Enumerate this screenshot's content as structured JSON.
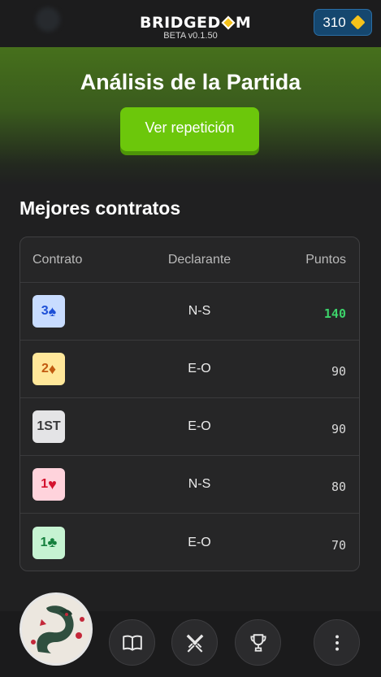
{
  "header": {
    "logo_text": "BRIDGEDOM",
    "logo_left": "BRIDGED",
    "logo_right": "M",
    "version": "BETA v0.1.50",
    "coins": "310"
  },
  "hero": {
    "title": "Análisis de la Partida",
    "replay_label": "Ver repetición"
  },
  "section": {
    "title": "Mejores contratos",
    "columns": [
      "Contrato",
      "Declarante",
      "Puntos"
    ],
    "rows": [
      {
        "level": "3",
        "suit_symbol": "♠",
        "suit": "spades",
        "declarer": "N-S",
        "points": "140",
        "badge_bg": "#c8dcff",
        "badge_fg": "#1d4fd6"
      },
      {
        "level": "2",
        "suit_symbol": "♦",
        "suit": "diamonds",
        "declarer": "E-O",
        "points": "90",
        "badge_bg": "#ffe79a",
        "badge_fg": "#c15a10"
      },
      {
        "level": "1ST",
        "suit_symbol": "",
        "suit": "no-trump",
        "declarer": "E-O",
        "points": "90",
        "badge_bg": "#e4e4e6",
        "badge_fg": "#3a3a3c"
      },
      {
        "level": "1",
        "suit_symbol": "♥",
        "suit": "hearts",
        "declarer": "N-S",
        "points": "80",
        "badge_bg": "#ffd3dc",
        "badge_fg": "#d4122e"
      },
      {
        "level": "1",
        "suit_symbol": "♣",
        "suit": "clubs",
        "declarer": "E-O",
        "points": "70",
        "badge_bg": "#c6f3d2",
        "badge_fg": "#15803d"
      }
    ]
  },
  "nav": {
    "items": [
      "book-icon",
      "crossed-swords-icon",
      "trophy-icon",
      "more-vertical-icon"
    ]
  },
  "colors": {
    "accent_green": "#6cc70b",
    "best_points": "#3cd36a",
    "coin": "#f6c21a"
  }
}
